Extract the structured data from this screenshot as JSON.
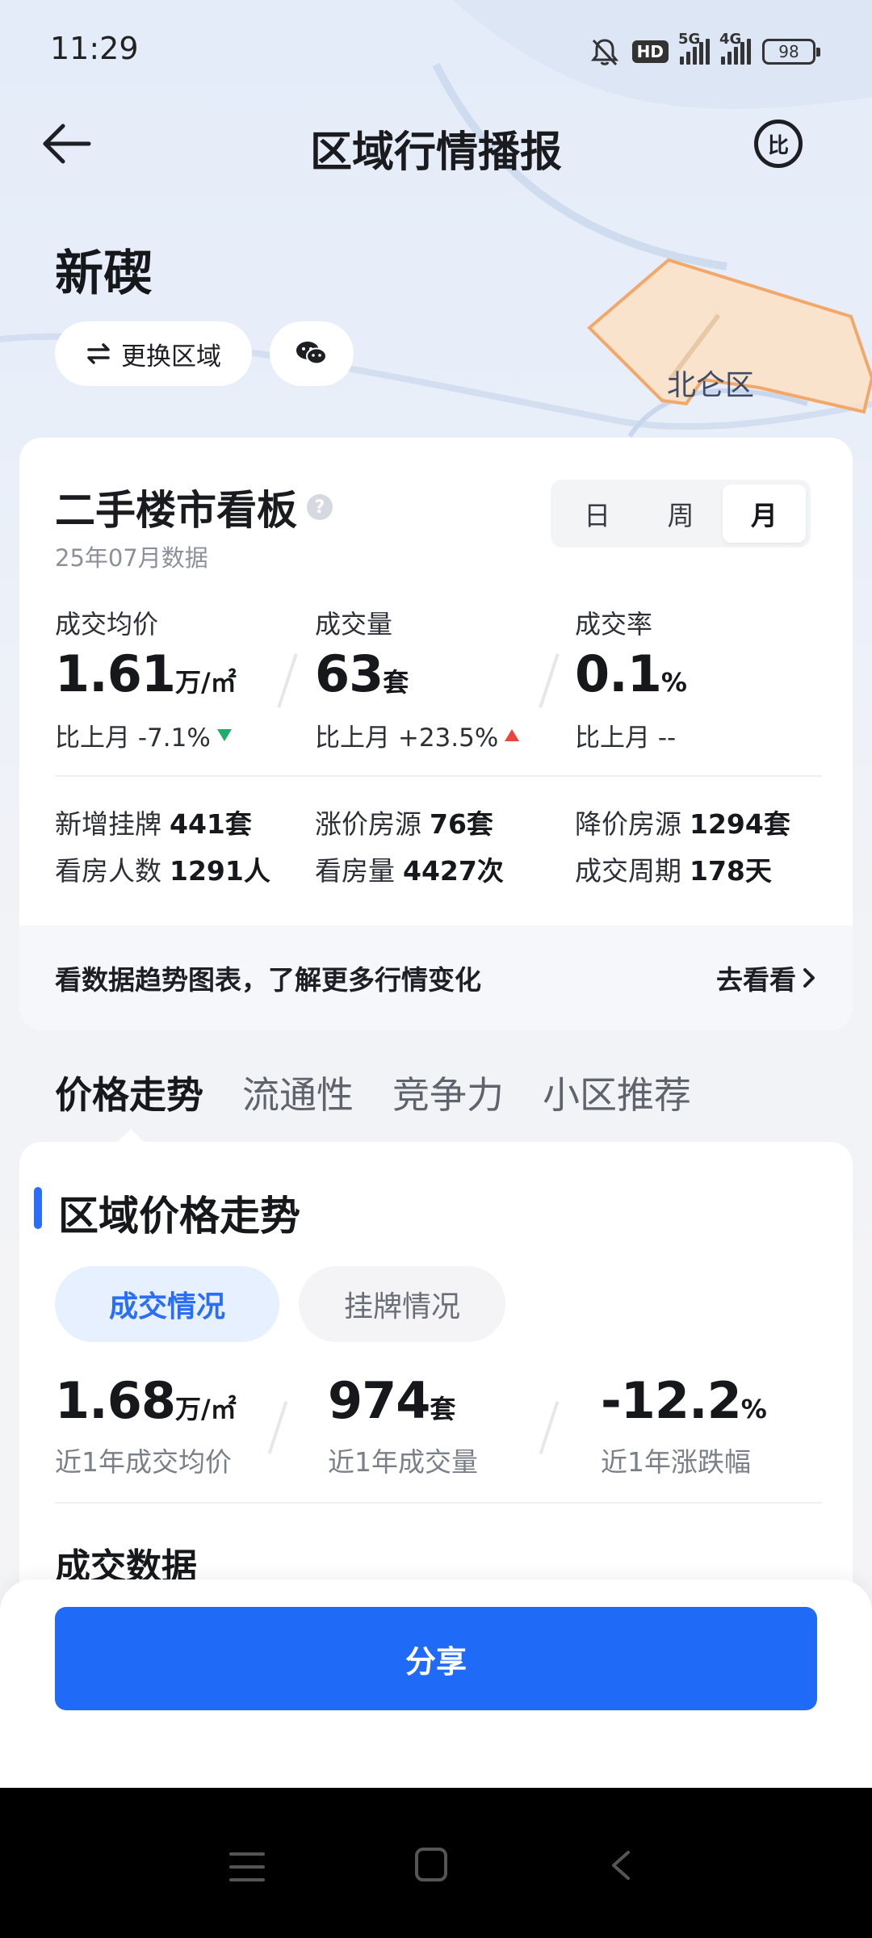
{
  "status_bar": {
    "time": "11:29",
    "hd_badge": "HD",
    "signal1_label": "5G",
    "signal2_label": "4G",
    "battery": "98"
  },
  "header": {
    "title": "区域行情播报",
    "compare_icon_text": "比"
  },
  "region": {
    "name": "新碶",
    "switch_label": "更换区域",
    "map_label": "北仑区"
  },
  "dashboard": {
    "title": "二手楼市看板",
    "help_icon": "?",
    "subtitle": "25年07月数据",
    "period_tabs": [
      "日",
      "周",
      "月"
    ],
    "selected_period": "月",
    "metrics": [
      {
        "label": "成交均价",
        "value": "1.61",
        "unit": "万/㎡",
        "compare": "比上月 -7.1%",
        "trend": "down"
      },
      {
        "label": "成交量",
        "value": "63",
        "unit": "套",
        "compare": "比上月 +23.5%",
        "trend": "up"
      },
      {
        "label": "成交率",
        "value": "0.1",
        "unit": "%",
        "compare": "比上月 --",
        "trend": "none"
      }
    ],
    "stats": [
      {
        "label": "新增挂牌",
        "value": "441套"
      },
      {
        "label": "涨价房源",
        "value": "76套"
      },
      {
        "label": "降价房源",
        "value": "1294套"
      },
      {
        "label": "看房人数",
        "value": "1291人"
      },
      {
        "label": "看房量",
        "value": "4427次"
      },
      {
        "label": "成交周期",
        "value": "178天"
      }
    ],
    "trend_banner": "看数据趋势图表，了解更多行情变化",
    "trend_link": "去看看"
  },
  "tabs": [
    "价格走势",
    "流通性",
    "竞争力",
    "小区推荐"
  ],
  "price_trend": {
    "title": "区域价格走势",
    "chips": [
      "成交情况",
      "挂牌情况"
    ],
    "yearly": [
      {
        "value": "1.68",
        "unit": "万/㎡",
        "label": "近1年成交均价"
      },
      {
        "value": "974",
        "unit": "套",
        "label": "近1年成交量"
      },
      {
        "value": "-12.2",
        "unit": "%",
        "label": "近1年涨跌幅"
      }
    ],
    "section_title": "成交数据"
  },
  "share": {
    "label": "分享"
  },
  "colors": {
    "accent": "#1f6bf7",
    "up": "#e8463f",
    "down": "#1fae6a"
  }
}
